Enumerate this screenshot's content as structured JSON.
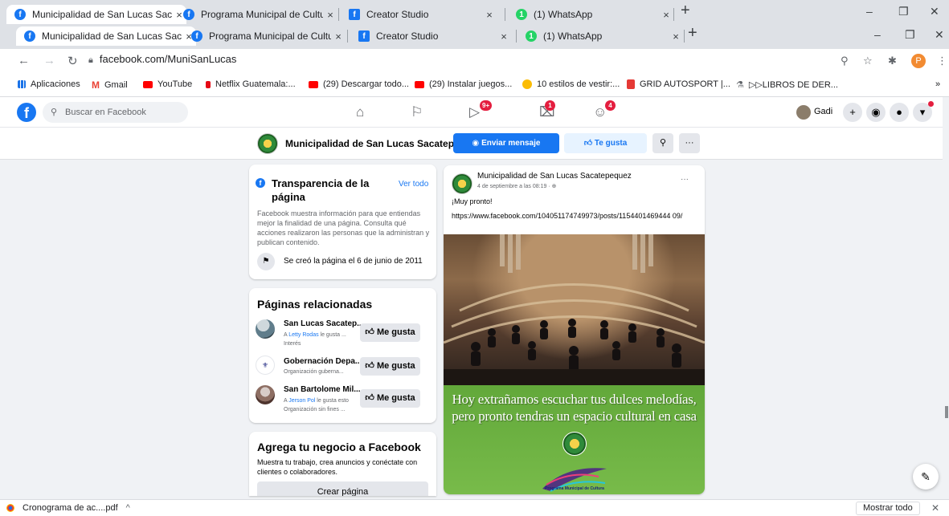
{
  "browser": {
    "tabs": [
      {
        "title": "Municipalidad de San Lucas Saca",
        "icon": "facebook-icon"
      },
      {
        "title": "Programa Municipal de Cultura P",
        "icon": "facebook-icon"
      },
      {
        "title": "Creator Studio",
        "icon": "facebook-icon"
      },
      {
        "title": "(1) WhatsApp",
        "icon": "whatsapp-icon"
      }
    ],
    "close_glyph": "×",
    "new_tab_glyph": "+",
    "url": "facebook.com/MuniSanLucas",
    "profile_initial": "P",
    "window_controls": {
      "minimize": "–",
      "maximize": "❐",
      "close": "✕"
    }
  },
  "bookmarks": [
    {
      "label": "Aplicaciones",
      "icon": "apps-icon"
    },
    {
      "label": "Gmail",
      "icon": "gmail-icon"
    },
    {
      "label": "YouTube",
      "icon": "youtube-icon"
    },
    {
      "label": "Netflix Guatemala:...",
      "icon": "netflix-icon"
    },
    {
      "label": "(29) Descargar todo...",
      "icon": "youtube-icon"
    },
    {
      "label": "(29) Instalar juegos...",
      "icon": "youtube-icon"
    },
    {
      "label": "10 estilos de vestir:...",
      "icon": "circle-icon"
    },
    {
      "label": "GRID AUTOSPORT |...",
      "icon": "grid-icon"
    },
    {
      "label": "▷▷LIBROS DE DER...",
      "icon": "book-icon"
    }
  ],
  "bookmarks_overflow": "»",
  "fb_nav": {
    "search_placeholder": "Buscar en Facebook",
    "badges": {
      "watch": "9+",
      "marketplace": "1",
      "groups": "4"
    },
    "user_name": "Gadi"
  },
  "page_header": {
    "name": "Municipalidad de San Lucas Sacatepe...",
    "send_message": "Enviar mensaje",
    "like": "Te gusta",
    "more": "···"
  },
  "transparency": {
    "title": "Transparencia de la página",
    "see_all": "Ver todo",
    "description": "Facebook muestra información para que entiendas mejor la finalidad de una página. Consulta qué acciones realizaron las personas que la administran y publican contenido.",
    "created": "Se creó la página el 6 de junio de 2011"
  },
  "related_pages": {
    "title": "Páginas relacionadas",
    "like_label": "Me gusta",
    "items": [
      {
        "name": "San Lucas Sacatep...",
        "sub_prefix": "A ",
        "friend": "Letty Rodas",
        "sub_suffix": " le gusta ...",
        "category": "Interés"
      },
      {
        "name": "Gobernación Depa...",
        "sub_prefix": "",
        "friend": "",
        "sub_suffix": "",
        "category": "Organización guberna..."
      },
      {
        "name": "San Bartolome Mil...",
        "sub_prefix": "A ",
        "friend": "Jerson Pol",
        "sub_suffix": " le gusta esto",
        "category": "Organización sin fines ..."
      }
    ]
  },
  "business": {
    "title": "Agrega tu negocio a Facebook",
    "description": "Muestra tu trabajo, crea anuncios y conéctate con clientes o colaboradores.",
    "button": "Crear página"
  },
  "post": {
    "author": "Municipalidad de San Lucas Sacatepequez",
    "date": "4 de septiembre a las 08:19 · ",
    "more": "···",
    "text": "¡Muy pronto!",
    "link": "https://www.facebook.com/104051174749973/posts/1154401469444 09/",
    "caption_line1": "Hoy extrañamos escuchar tus dulces melodías,",
    "caption_line2": "pero pronto tendras un espacio cultural en casa",
    "emblem_text": "Programa Municipal de Cultura"
  },
  "downloads": {
    "file": "Cronograma de ac....pdf",
    "chevron": "^",
    "show_all": "Mostrar todo",
    "close": "✕"
  },
  "colors": {
    "fb_blue": "#1877f2",
    "badge_red": "#e41e3f",
    "banner_green": "#6cb040"
  }
}
